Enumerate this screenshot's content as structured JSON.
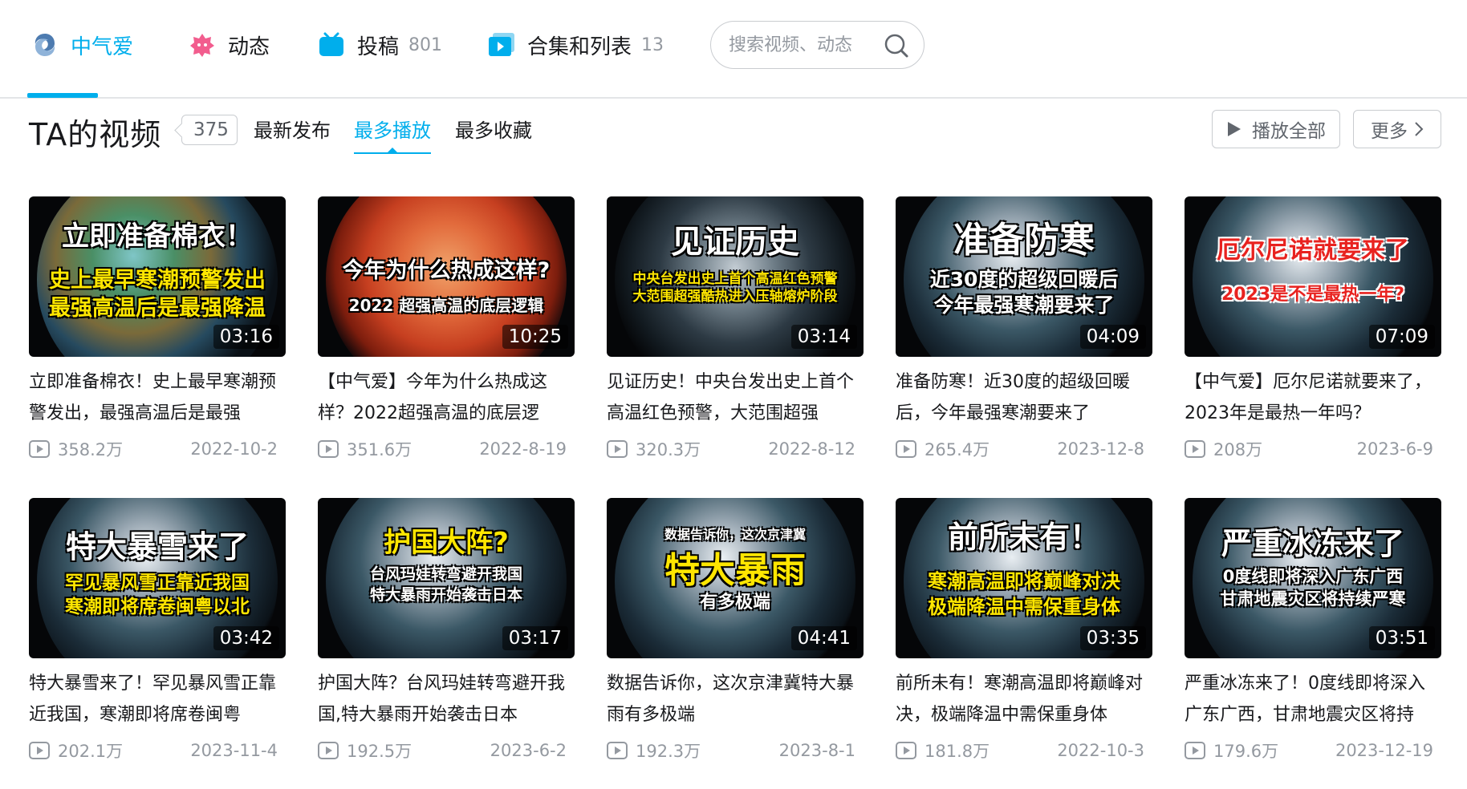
{
  "nav": {
    "home": {
      "label": "中气爱"
    },
    "dynamic": {
      "label": "动态"
    },
    "posts": {
      "label": "投稿",
      "count": "801"
    },
    "collections": {
      "label": "合集和列表",
      "count": "13"
    },
    "search": {
      "placeholder": "搜索视频、动态"
    }
  },
  "section": {
    "title": "TA的视频",
    "count": "375",
    "sort_tabs": [
      "最新发布",
      "最多播放",
      "最多收藏"
    ],
    "active_sort": "最多播放",
    "play_all": "播放全部",
    "more": "更多"
  },
  "videos": [
    {
      "thumb_lines": [
        "立即准备棉衣！",
        "史上最早寒潮预警发出",
        "最强高温后是最强降温"
      ],
      "duration": "03:16",
      "title": "立即准备棉衣！史上最早寒潮预警发出，最强高温后是最强",
      "views": "358.2万",
      "date": "2022-10-2"
    },
    {
      "thumb_lines": [
        "今年为什么热成这样?",
        "2022 超强高温的底层逻辑"
      ],
      "duration": "10:25",
      "title": "【中气爱】今年为什么热成这样？2022超强高温的底层逻",
      "views": "351.6万",
      "date": "2022-8-19"
    },
    {
      "thumb_lines": [
        "见证历史",
        "中央台发出史上首个高温红色预警",
        "大范围超强酷热进入压轴熔炉阶段"
      ],
      "duration": "03:14",
      "title": "见证历史！中央台发出史上首个高温红色预警，大范围超强",
      "views": "320.3万",
      "date": "2022-8-12"
    },
    {
      "thumb_lines": [
        "准备防寒",
        "近30度的超级回暖后",
        "今年最强寒潮要来了"
      ],
      "duration": "04:09",
      "title": "准备防寒！近30度的超级回暖后，今年最强寒潮要来了",
      "views": "265.4万",
      "date": "2023-12-8"
    },
    {
      "thumb_lines": [
        "厄尔尼诺就要来了",
        "2023是不是最热一年?"
      ],
      "duration": "07:09",
      "title": "【中气爱】厄尔尼诺就要来了，2023年是最热一年吗？",
      "views": "208万",
      "date": "2023-6-9"
    },
    {
      "thumb_lines": [
        "特大暴雪来了",
        "罕见暴风雪正靠近我国",
        "寒潮即将席卷闽粤以北"
      ],
      "duration": "03:42",
      "title": "特大暴雪来了！罕见暴风雪正靠近我国，寒潮即将席卷闽粤",
      "views": "202.1万",
      "date": "2023-11-4"
    },
    {
      "thumb_lines": [
        "护国大阵?",
        "台风玛娃转弯避开我国",
        "特大暴雨开始袭击日本"
      ],
      "duration": "03:17",
      "title": "护国大阵？台风玛娃转弯避开我国,特大暴雨开始袭击日本",
      "views": "192.5万",
      "date": "2023-6-2"
    },
    {
      "thumb_lines": [
        "数据告诉你，这次京津冀",
        "特大暴雨",
        "有多极端"
      ],
      "duration": "04:41",
      "title": "数据告诉你，这次京津冀特大暴雨有多极端",
      "views": "192.3万",
      "date": "2023-8-1"
    },
    {
      "thumb_lines": [
        "前所未有！",
        "寒潮高温即将巅峰对决",
        "极端降温中需保重身体"
      ],
      "duration": "03:35",
      "title": "前所未有！寒潮高温即将巅峰对决，极端降温中需保重身体",
      "views": "181.8万",
      "date": "2022-10-3"
    },
    {
      "thumb_lines": [
        "严重冰冻来了",
        "0度线即将深入广东广西",
        "甘肃地震灾区将持续严寒"
      ],
      "duration": "03:51",
      "title": "严重冰冻来了！0度线即将深入广东广西，甘肃地震灾区将持",
      "views": "179.6万",
      "date": "2023-12-19"
    }
  ],
  "colors": {
    "accent": "#00aeec",
    "text": "#18191c",
    "muted": "#9499a0"
  }
}
